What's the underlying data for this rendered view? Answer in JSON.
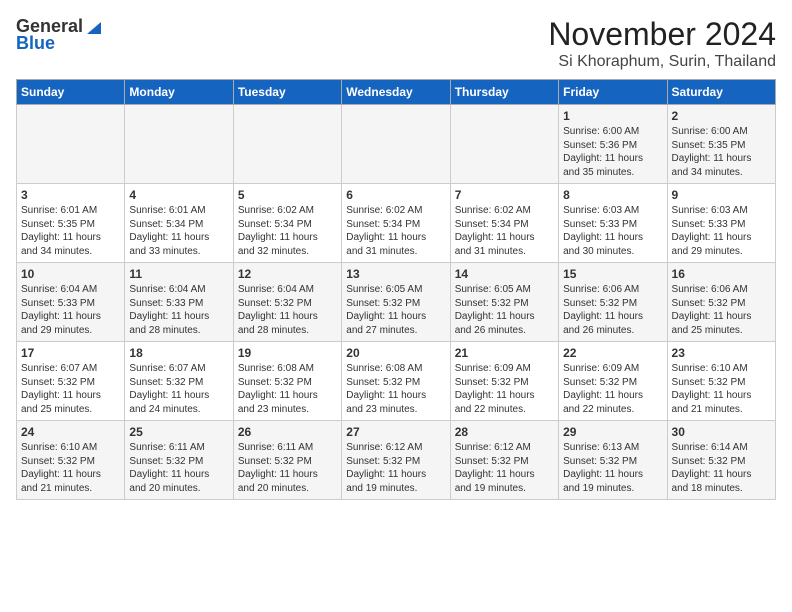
{
  "header": {
    "logo_line1": "General",
    "logo_line2": "Blue",
    "month": "November 2024",
    "location": "Si Khoraphum, Surin, Thailand"
  },
  "weekdays": [
    "Sunday",
    "Monday",
    "Tuesday",
    "Wednesday",
    "Thursday",
    "Friday",
    "Saturday"
  ],
  "weeks": [
    [
      {
        "day": "",
        "info": ""
      },
      {
        "day": "",
        "info": ""
      },
      {
        "day": "",
        "info": ""
      },
      {
        "day": "",
        "info": ""
      },
      {
        "day": "",
        "info": ""
      },
      {
        "day": "1",
        "info": "Sunrise: 6:00 AM\nSunset: 5:36 PM\nDaylight: 11 hours\nand 35 minutes."
      },
      {
        "day": "2",
        "info": "Sunrise: 6:00 AM\nSunset: 5:35 PM\nDaylight: 11 hours\nand 34 minutes."
      }
    ],
    [
      {
        "day": "3",
        "info": "Sunrise: 6:01 AM\nSunset: 5:35 PM\nDaylight: 11 hours\nand 34 minutes."
      },
      {
        "day": "4",
        "info": "Sunrise: 6:01 AM\nSunset: 5:34 PM\nDaylight: 11 hours\nand 33 minutes."
      },
      {
        "day": "5",
        "info": "Sunrise: 6:02 AM\nSunset: 5:34 PM\nDaylight: 11 hours\nand 32 minutes."
      },
      {
        "day": "6",
        "info": "Sunrise: 6:02 AM\nSunset: 5:34 PM\nDaylight: 11 hours\nand 31 minutes."
      },
      {
        "day": "7",
        "info": "Sunrise: 6:02 AM\nSunset: 5:34 PM\nDaylight: 11 hours\nand 31 minutes."
      },
      {
        "day": "8",
        "info": "Sunrise: 6:03 AM\nSunset: 5:33 PM\nDaylight: 11 hours\nand 30 minutes."
      },
      {
        "day": "9",
        "info": "Sunrise: 6:03 AM\nSunset: 5:33 PM\nDaylight: 11 hours\nand 29 minutes."
      }
    ],
    [
      {
        "day": "10",
        "info": "Sunrise: 6:04 AM\nSunset: 5:33 PM\nDaylight: 11 hours\nand 29 minutes."
      },
      {
        "day": "11",
        "info": "Sunrise: 6:04 AM\nSunset: 5:33 PM\nDaylight: 11 hours\nand 28 minutes."
      },
      {
        "day": "12",
        "info": "Sunrise: 6:04 AM\nSunset: 5:32 PM\nDaylight: 11 hours\nand 28 minutes."
      },
      {
        "day": "13",
        "info": "Sunrise: 6:05 AM\nSunset: 5:32 PM\nDaylight: 11 hours\nand 27 minutes."
      },
      {
        "day": "14",
        "info": "Sunrise: 6:05 AM\nSunset: 5:32 PM\nDaylight: 11 hours\nand 26 minutes."
      },
      {
        "day": "15",
        "info": "Sunrise: 6:06 AM\nSunset: 5:32 PM\nDaylight: 11 hours\nand 26 minutes."
      },
      {
        "day": "16",
        "info": "Sunrise: 6:06 AM\nSunset: 5:32 PM\nDaylight: 11 hours\nand 25 minutes."
      }
    ],
    [
      {
        "day": "17",
        "info": "Sunrise: 6:07 AM\nSunset: 5:32 PM\nDaylight: 11 hours\nand 25 minutes."
      },
      {
        "day": "18",
        "info": "Sunrise: 6:07 AM\nSunset: 5:32 PM\nDaylight: 11 hours\nand 24 minutes."
      },
      {
        "day": "19",
        "info": "Sunrise: 6:08 AM\nSunset: 5:32 PM\nDaylight: 11 hours\nand 23 minutes."
      },
      {
        "day": "20",
        "info": "Sunrise: 6:08 AM\nSunset: 5:32 PM\nDaylight: 11 hours\nand 23 minutes."
      },
      {
        "day": "21",
        "info": "Sunrise: 6:09 AM\nSunset: 5:32 PM\nDaylight: 11 hours\nand 22 minutes."
      },
      {
        "day": "22",
        "info": "Sunrise: 6:09 AM\nSunset: 5:32 PM\nDaylight: 11 hours\nand 22 minutes."
      },
      {
        "day": "23",
        "info": "Sunrise: 6:10 AM\nSunset: 5:32 PM\nDaylight: 11 hours\nand 21 minutes."
      }
    ],
    [
      {
        "day": "24",
        "info": "Sunrise: 6:10 AM\nSunset: 5:32 PM\nDaylight: 11 hours\nand 21 minutes."
      },
      {
        "day": "25",
        "info": "Sunrise: 6:11 AM\nSunset: 5:32 PM\nDaylight: 11 hours\nand 20 minutes."
      },
      {
        "day": "26",
        "info": "Sunrise: 6:11 AM\nSunset: 5:32 PM\nDaylight: 11 hours\nand 20 minutes."
      },
      {
        "day": "27",
        "info": "Sunrise: 6:12 AM\nSunset: 5:32 PM\nDaylight: 11 hours\nand 19 minutes."
      },
      {
        "day": "28",
        "info": "Sunrise: 6:12 AM\nSunset: 5:32 PM\nDaylight: 11 hours\nand 19 minutes."
      },
      {
        "day": "29",
        "info": "Sunrise: 6:13 AM\nSunset: 5:32 PM\nDaylight: 11 hours\nand 19 minutes."
      },
      {
        "day": "30",
        "info": "Sunrise: 6:14 AM\nSunset: 5:32 PM\nDaylight: 11 hours\nand 18 minutes."
      }
    ]
  ]
}
